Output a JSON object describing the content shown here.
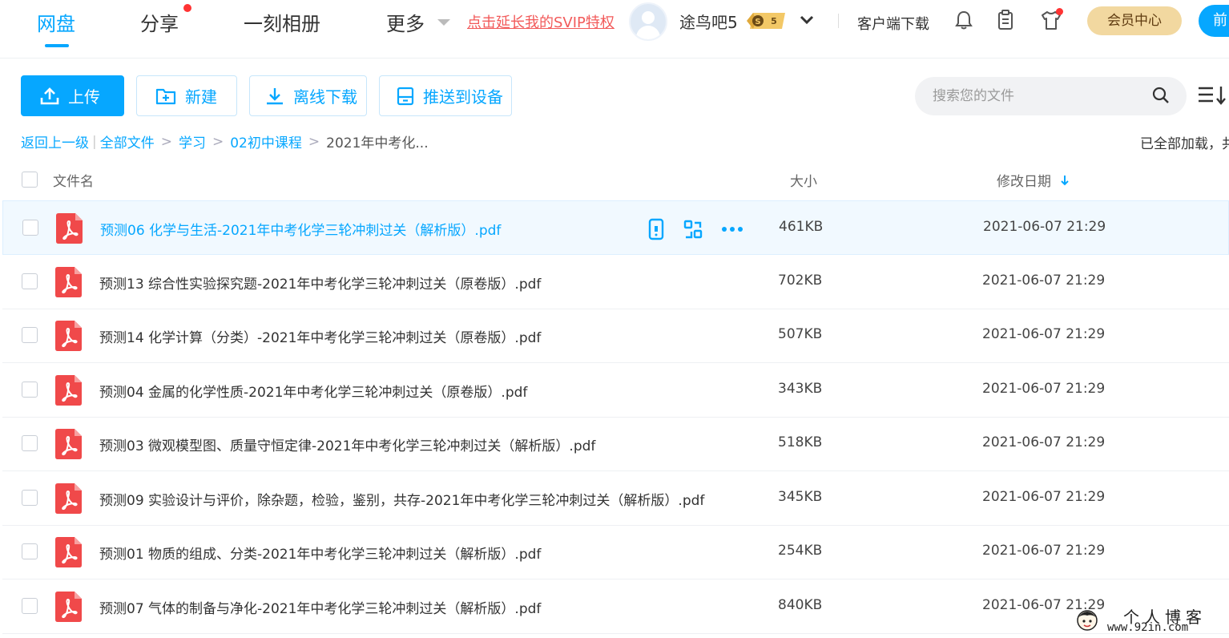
{
  "nav": {
    "items": [
      {
        "label": "网盘",
        "active": true
      },
      {
        "label": "分享",
        "has_dot": true
      },
      {
        "label": "一刻相册"
      },
      {
        "label": "更多"
      }
    ],
    "svip_link": "点击延长我的SVIP特权",
    "username": "途鸟吧5",
    "vip_badge": "S 5",
    "client_download": "客户端下载",
    "icons": [
      "bell-icon",
      "clipboard-icon",
      "tshirt-icon"
    ],
    "member_center": "会员中心",
    "edge_button": "前"
  },
  "toolbar": {
    "upload": "上传",
    "new_folder": "新建",
    "offline_download": "离线下载",
    "push_device": "推送到设备",
    "search_placeholder": "搜索您的文件"
  },
  "breadcrumb": {
    "back": "返回上一级",
    "all_files": "全部文件",
    "path": [
      "学习",
      "02初中课程"
    ],
    "current": "2021年中考化..."
  },
  "status_text": "已全部加载，共",
  "table": {
    "headers": {
      "name": "文件名",
      "size": "大小",
      "date": "修改日期"
    },
    "sort_column": "date",
    "rows": [
      {
        "name": "预测06 化学与生活-2021年中考化学三轮冲刺过关（解析版）.pdf",
        "size": "461KB",
        "date": "2021-06-07 21:29",
        "selected": true
      },
      {
        "name": "预测13 综合性实验探究题-2021年中考化学三轮冲刺过关（原卷版）.pdf",
        "size": "702KB",
        "date": "2021-06-07 21:29"
      },
      {
        "name": "预测14 化学计算（分类）-2021年中考化学三轮冲刺过关（原卷版）.pdf",
        "size": "507KB",
        "date": "2021-06-07 21:29"
      },
      {
        "name": "预测04 金属的化学性质-2021年中考化学三轮冲刺过关（原卷版）.pdf",
        "size": "343KB",
        "date": "2021-06-07 21:29"
      },
      {
        "name": "预测03 微观模型图、质量守恒定律-2021年中考化学三轮冲刺过关（解析版）.pdf",
        "size": "518KB",
        "date": "2021-06-07 21:29"
      },
      {
        "name": "预测09 实验设计与评价，除杂题，检验，鉴别，共存-2021年中考化学三轮冲刺过关（解析版）.pdf",
        "size": "345KB",
        "date": "2021-06-07 21:29"
      },
      {
        "name": "预测01 物质的组成、分类-2021年中考化学三轮冲刺过关（解析版）.pdf",
        "size": "254KB",
        "date": "2021-06-07 21:29"
      },
      {
        "name": "预测07 气体的制备与净化-2021年中考化学三轮冲刺过关（解析版）.pdf",
        "size": "840KB",
        "date": "2021-06-07 21:29"
      }
    ]
  },
  "watermark": {
    "title": "个人博客",
    "url": "www.92in.com"
  },
  "colors": {
    "accent": "#06a7ff",
    "pdf_red": "#f0494a",
    "svip_red": "#f25a5a",
    "member_gold": "#f2d8a0"
  }
}
